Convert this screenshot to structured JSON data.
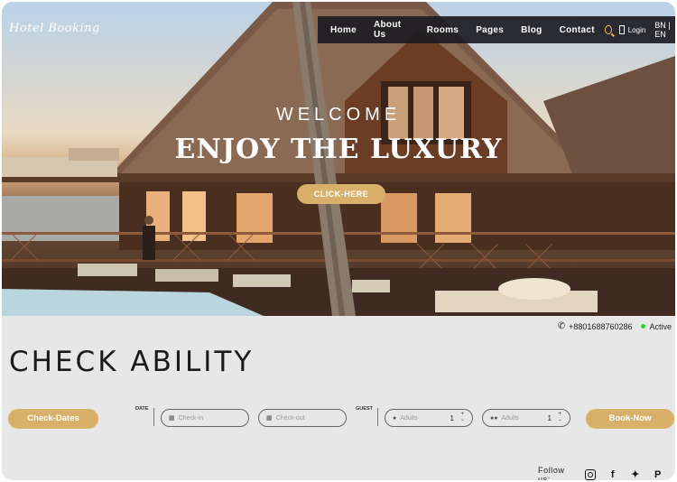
{
  "brand": "Hotel Booking",
  "nav": {
    "items": [
      "Home",
      "About Us",
      "Rooms",
      "Pages",
      "Blog",
      "Contact"
    ],
    "login": "Login",
    "language": "BN | EN"
  },
  "hero": {
    "welcome": "WELCOME",
    "headline": "ENJOY THE LUXURY",
    "cta": "CLICK-HERE"
  },
  "contact": {
    "phone": "+8801688760286",
    "status": "Active",
    "status_color": "#2ecc40"
  },
  "booking": {
    "title": "CHECK ABILITY",
    "check_dates_label": "Check-Dates",
    "date_group_label": "DATE",
    "guest_group_label": "GUEST",
    "checkin_placeholder": "Check-in",
    "checkout_placeholder": "Check-out",
    "adults_placeholder_1": "Adults",
    "adults_value_1": "1",
    "adults_placeholder_2": "Adults",
    "adults_value_2": "1",
    "book_now_label": "Book-Now",
    "accent_color": "#d9b06a"
  },
  "footer": {
    "follow_label": "Follow us:",
    "social_icons": [
      "instagram-icon",
      "facebook-icon",
      "twitter-icon",
      "pinterest-icon"
    ]
  }
}
